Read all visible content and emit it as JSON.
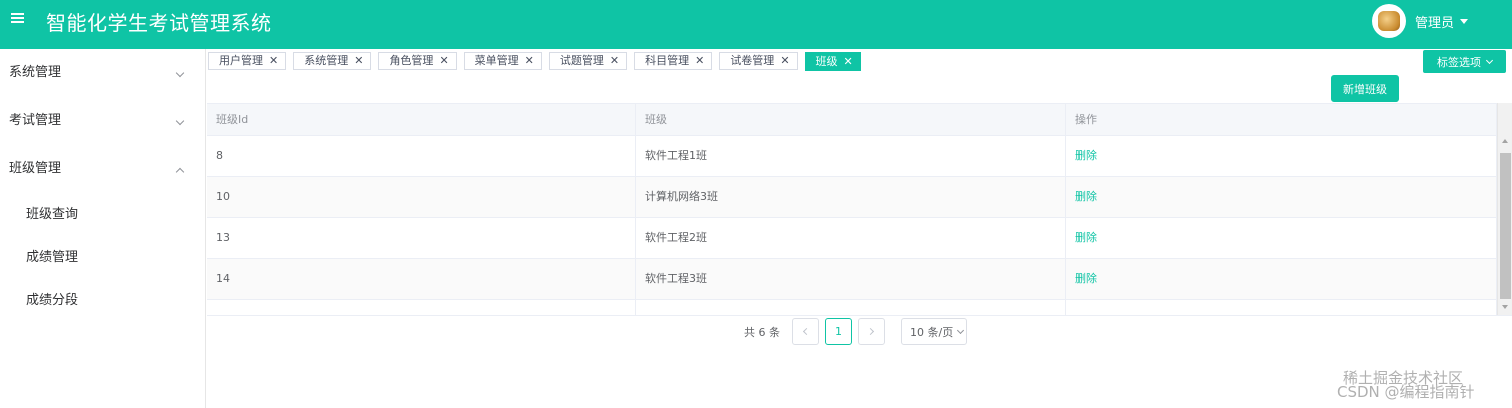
{
  "header": {
    "title": "智能化学生考试管理系统",
    "user_name": "管理员"
  },
  "sidebar": {
    "groups": [
      {
        "label": "系统管理",
        "expanded": false
      },
      {
        "label": "考试管理",
        "expanded": false
      },
      {
        "label": "班级管理",
        "expanded": true
      }
    ],
    "sub_items": [
      "班级查询",
      "成绩管理",
      "成绩分段"
    ]
  },
  "tags": [
    {
      "label": "用户管理",
      "active": false
    },
    {
      "label": "系统管理",
      "active": false
    },
    {
      "label": "角色管理",
      "active": false
    },
    {
      "label": "菜单管理",
      "active": false
    },
    {
      "label": "试题管理",
      "active": false
    },
    {
      "label": "科目管理",
      "active": false
    },
    {
      "label": "试卷管理",
      "active": false
    },
    {
      "label": "班级",
      "active": true
    }
  ],
  "tag_close_glyph": "✕",
  "tag_options_label": "标签选项",
  "add_button_label": "新增班级",
  "table": {
    "columns": [
      "班级Id",
      "班级",
      "操作"
    ],
    "rows": [
      {
        "id": "8",
        "name": "软件工程1班",
        "action": "删除"
      },
      {
        "id": "10",
        "name": "计算机网络3班",
        "action": "删除"
      },
      {
        "id": "13",
        "name": "软件工程2班",
        "action": "删除"
      },
      {
        "id": "14",
        "name": "软件工程3班",
        "action": "删除"
      }
    ]
  },
  "pagination": {
    "total_text": "共 6 条",
    "current_page": "1",
    "page_size": "10 条/页"
  },
  "watermark": {
    "line1": "稀土掘金技术社区",
    "line2": "CSDN @编程指南针"
  },
  "colors": {
    "accent": "#0fc4a5",
    "sidebar_border": "#e6e6e6",
    "table_header_bg": "#f5f7fa"
  }
}
